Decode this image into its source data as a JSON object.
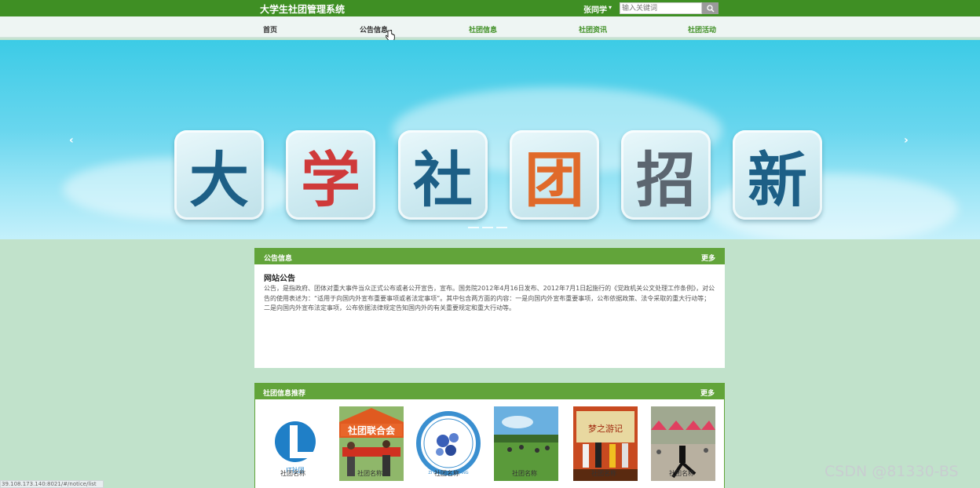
{
  "header": {
    "site_title": "大学生社团管理系统",
    "user_name": "张同学",
    "search_placeholder": "输入关键词"
  },
  "nav": {
    "items": [
      {
        "label": "首页"
      },
      {
        "label": "公告信息"
      },
      {
        "label": "社团信息"
      },
      {
        "label": "社团资讯"
      },
      {
        "label": "社团活动"
      }
    ]
  },
  "banner": {
    "chars": [
      "大",
      "学",
      "社",
      "团",
      "招",
      "新"
    ],
    "char_colors": [
      "#1d5f86",
      "#cf3a3a",
      "#1d5f86",
      "#e06a2a",
      "#5c6670",
      "#1d5f86"
    ]
  },
  "notice_panel": {
    "title": "公告信息",
    "more": "更多",
    "item_title": "网站公告",
    "item_body": "公告，是指政府、团体对重大事件当众正式公布或者公开宣告，宣布。国务院2012年4月16日发布、2012年7月1日起施行的《党政机关公文处理工作条例》，对公告的使用表述为：“适用于向国内外宣布重要事项或者法定事项”。其中包含两方面的内容：一是向国内外宣布重要事项，公布依据政策、法令采取的重大行动等；二是向国内外宣布法定事项，公布依据法律规定告知国内外的有关重要规定和重大行动等。"
  },
  "club_panel": {
    "title": "社团信息推荐",
    "more": "更多",
    "cards": [
      {
        "img_text": "IT社团",
        "label": "社团名称"
      },
      {
        "img_text": "社团联合会",
        "label": "社团名称"
      },
      {
        "img_text": "ZI CHUAN PAN YANG",
        "label": "社团名称"
      },
      {
        "img_text": "",
        "label": "社团名称"
      },
      {
        "img_text": "梦之游记",
        "label": "社团名称"
      },
      {
        "img_text": "",
        "label": "社团名称"
      }
    ]
  },
  "status_bar": {
    "url": "39.108.173.140:8021/#/notice/list"
  },
  "watermark": "CSDN @81330-BS",
  "colors": {
    "topbar": "#3f8f24",
    "panel_header": "#62a43a",
    "page_bg": "#c1e2cb"
  }
}
